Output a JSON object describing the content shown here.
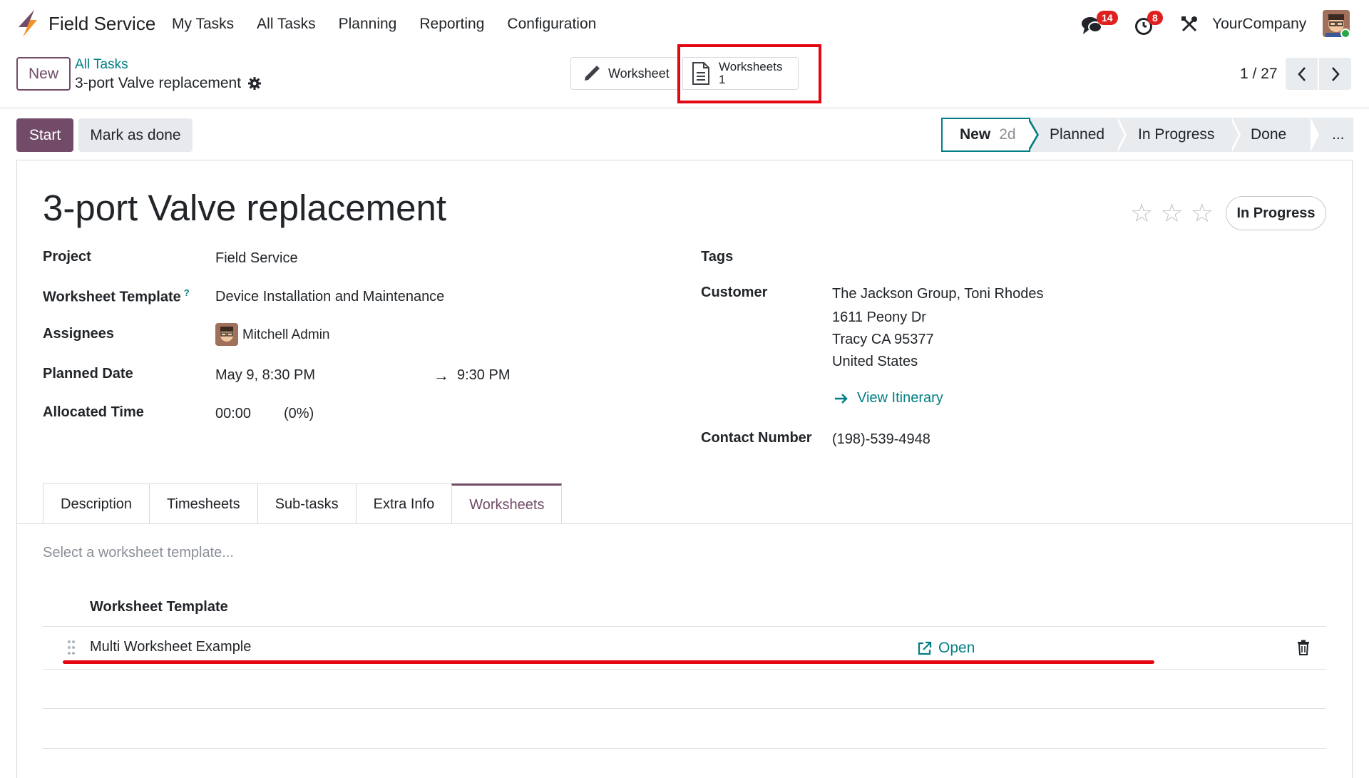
{
  "navbar": {
    "app_name": "Field Service",
    "menu": [
      "My Tasks",
      "All Tasks",
      "Planning",
      "Reporting",
      "Configuration"
    ],
    "messages_count": "14",
    "activities_count": "8",
    "company": "YourCompany"
  },
  "control_panel": {
    "new_label": "New",
    "breadcrumb_parent": "All Tasks",
    "breadcrumb_current": "3-port Valve replacement",
    "worksheet_btn_label": "Worksheet",
    "worksheets_btn_label": "Worksheets",
    "worksheets_btn_count": "1",
    "pager": "1 / 27"
  },
  "statusbar": {
    "start_label": "Start",
    "mark_done_label": "Mark as done",
    "stages": [
      {
        "label": "New",
        "duration": "2d"
      },
      {
        "label": "Planned"
      },
      {
        "label": "In Progress"
      },
      {
        "label": "Done"
      },
      {
        "label": "..."
      }
    ]
  },
  "form": {
    "title": "3-port Valve replacement",
    "state": "In Progress",
    "left_fields": {
      "project_label": "Project",
      "project_value": "Field Service",
      "template_label": "Worksheet Template",
      "template_help": "?",
      "template_value": "Device Installation and Maintenance",
      "assignees_label": "Assignees",
      "assignees_value": "Mitchell Admin",
      "planned_label": "Planned Date",
      "planned_start": "May 9, 8:30 PM",
      "planned_arrow": "→",
      "planned_end": "9:30 PM",
      "allocated_label": "Allocated Time",
      "allocated_value": "00:00",
      "allocated_pct": "(0%)"
    },
    "right_fields": {
      "tags_label": "Tags",
      "customer_label": "Customer",
      "customer_name": "The Jackson Group, Toni Rhodes",
      "address_line1": "1611 Peony Dr",
      "address_line2": "Tracy CA 95377",
      "address_line3": "United States",
      "itinerary_label": "View Itinerary",
      "contact_label": "Contact Number",
      "contact_value": "(198)-539-4948"
    }
  },
  "tabs": [
    "Description",
    "Timesheets",
    "Sub-tasks",
    "Extra Info",
    "Worksheets"
  ],
  "worksheets_tab": {
    "placeholder": "Select a worksheet template...",
    "column_header": "Worksheet Template",
    "rows": [
      {
        "name": "Multi Worksheet Example",
        "action": "Open"
      }
    ]
  },
  "colors": {
    "primary": "#714b67",
    "teal": "#017e84",
    "highlight_red": "#e30613"
  }
}
